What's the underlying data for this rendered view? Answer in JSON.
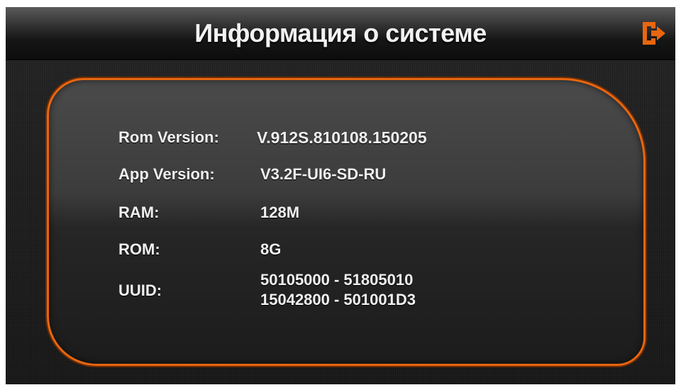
{
  "header": {
    "title": "Информация о системе",
    "exit_icon": "exit-icon",
    "accent_color": "#e8660f"
  },
  "info": {
    "rom_version": {
      "label": "Rom Version:",
      "value": "V.912S.810108.150205"
    },
    "app_version": {
      "label": "App Version:",
      "value": "V3.2F-UI6-SD-RU"
    },
    "ram": {
      "label": "RAM:",
      "value": "128M"
    },
    "rom": {
      "label": "ROM:",
      "value": "8G"
    },
    "uuid": {
      "label": "UUID:",
      "value_line1": "50105000 - 51805010",
      "value_line2": "15042800 - 501001D3"
    }
  }
}
